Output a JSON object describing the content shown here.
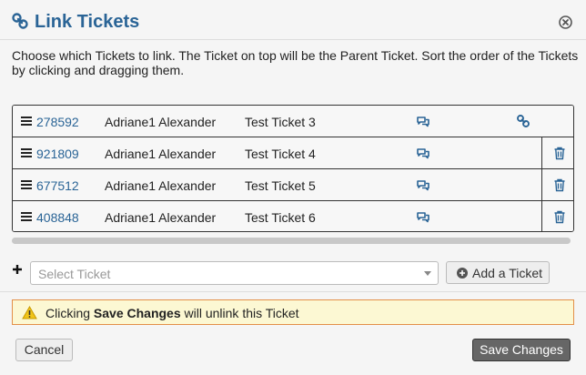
{
  "header": {
    "title": "Link Tickets"
  },
  "intro_text": "Choose which Tickets to link. The Ticket on top will be the Parent Ticket. Sort the order of the Tickets by clicking and dragging them.",
  "tickets": [
    {
      "id": "278592",
      "name": "Adriane1 Alexander",
      "subject": "Test Ticket 3",
      "is_parent": true
    },
    {
      "id": "921809",
      "name": "Adriane1 Alexander",
      "subject": "Test Ticket 4",
      "is_parent": false
    },
    {
      "id": "677512",
      "name": "Adriane1 Alexander",
      "subject": "Test Ticket 5",
      "is_parent": false
    },
    {
      "id": "408848",
      "name": "Adriane1 Alexander",
      "subject": "Test Ticket 6",
      "is_parent": false
    }
  ],
  "add": {
    "select_placeholder": "Select Ticket",
    "add_button_label": "Add a Ticket"
  },
  "warning": {
    "prefix": "Clicking ",
    "bold": "Save Changes",
    "suffix": " will unlink this Ticket"
  },
  "footer": {
    "cancel_label": "Cancel",
    "save_label": "Save Changes"
  },
  "colors": {
    "accent": "#2a6496",
    "warning_bg": "#fcf8d3",
    "warning_border": "#e38f49",
    "save_bg": "#666666"
  }
}
